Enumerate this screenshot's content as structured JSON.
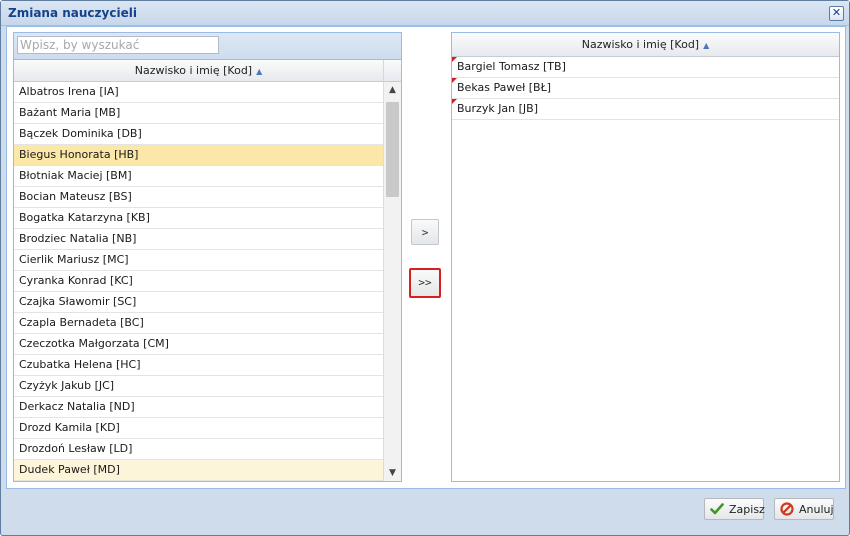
{
  "dialog": {
    "title": "Zmiana nauczycieli",
    "close_icon": "close-icon"
  },
  "left": {
    "search_placeholder": "Wpisz, by wyszukać",
    "column_header": "Nazwisko i imię [Kod]",
    "sort_icon": "sort-asc-icon",
    "rows": [
      "Albatros Irena [IA]",
      "Bażant Maria [MB]",
      "Bączek Dominika [DB]",
      "Biegus Honorata [HB]",
      "Błotniak Maciej [BM]",
      "Bocian Mateusz [BS]",
      "Bogatka Katarzyna [KB]",
      "Brodziec Natalia [NB]",
      "Cierlik Mariusz [MC]",
      "Cyranka Konrad [KC]",
      "Czajka Sławomir [SC]",
      "Czapla Bernadeta [BC]",
      "Czeczotka Małgorzata [CM]",
      "Czubatka Helena [HC]",
      "Czyżyk Jakub [JC]",
      "Derkacz Natalia [ND]",
      "Drozd Kamila [KD]",
      "Drozdoń Lesław [LD]",
      "Dudek Paweł [MD]"
    ],
    "selected_row": "Biegus Honorata [HB]",
    "hover_row": "Dudek Paweł [MD]"
  },
  "transfer": {
    "move_one": ">",
    "move_all": ">>"
  },
  "right": {
    "column_header": "Nazwisko i imię [Kod]",
    "rows": [
      "Bargiel Tomasz [TB]",
      "Bekas Paweł [BŁ]",
      "Burzyk Jan [JB]"
    ]
  },
  "footer": {
    "save_label": "Zapisz",
    "cancel_label": "Anuluj",
    "save_icon": "checkmark-icon",
    "cancel_icon": "cancel-icon"
  },
  "colors": {
    "selected_row": "#fbe7a8",
    "hover_row": "#fdf5d9",
    "highlight_border": "#d61f1f",
    "dirty_marker": "#d02020"
  }
}
